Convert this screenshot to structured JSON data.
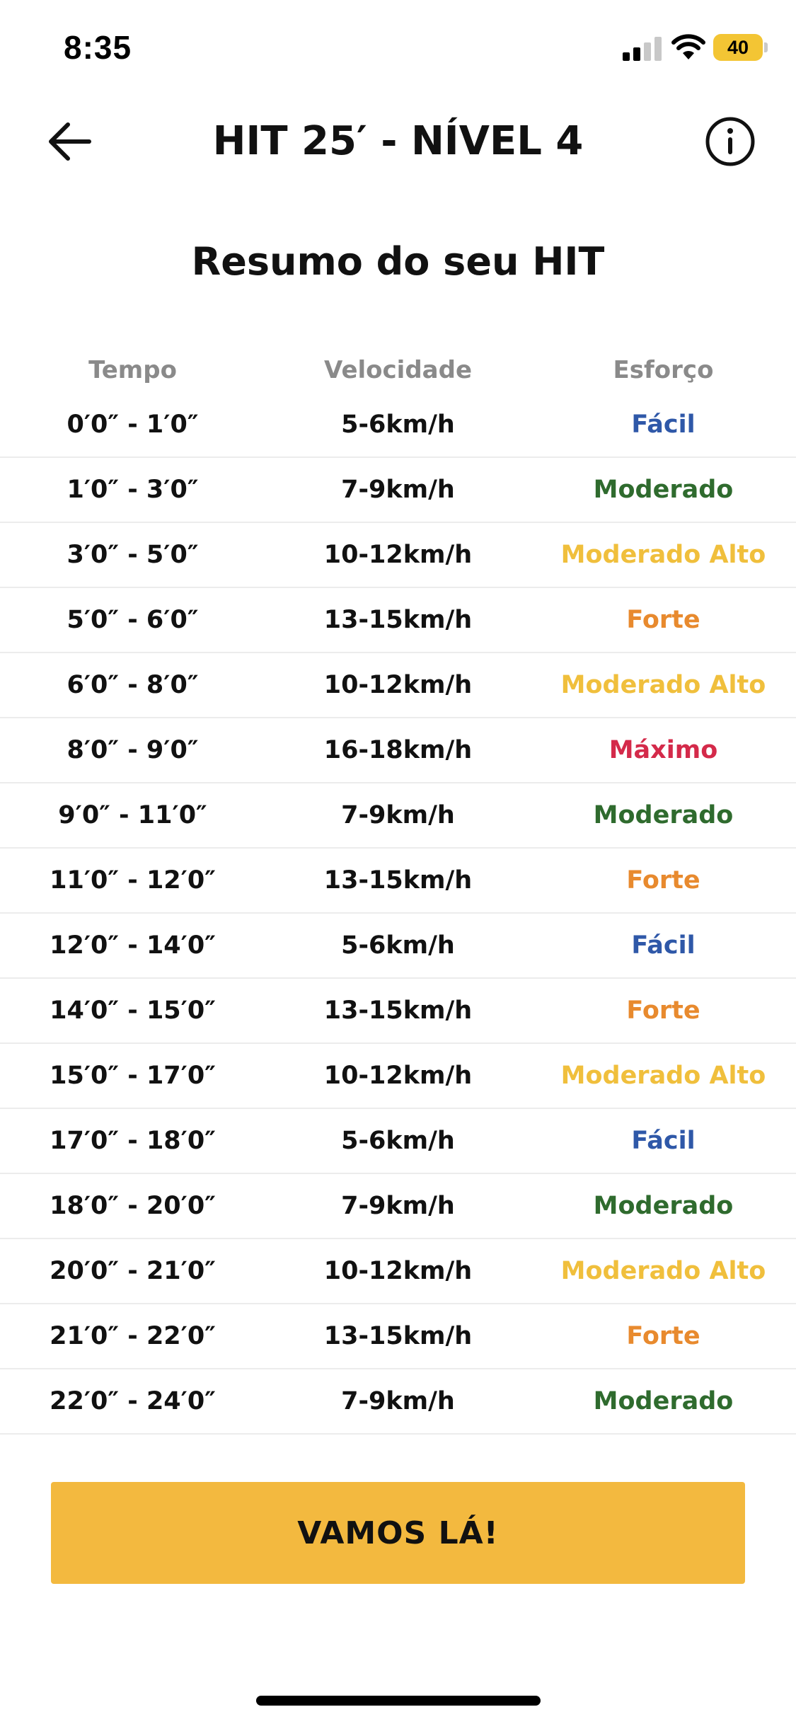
{
  "status_bar": {
    "time": "8:35",
    "battery": "40",
    "signal_icon": "cellular-signal-icon",
    "wifi_icon": "wifi-icon"
  },
  "header": {
    "title": "HIT 25′ - NÍVEL 4",
    "back_icon": "arrow-left-icon",
    "info_icon": "info-circle-icon"
  },
  "summary": {
    "title": "Resumo do seu HIT"
  },
  "table": {
    "headers": {
      "time": "Tempo",
      "speed": "Velocidade",
      "effort": "Esforço"
    },
    "rows": [
      {
        "time": "0′0″ - 1′0″",
        "speed": "5-6km/h",
        "effort": "Fácil"
      },
      {
        "time": "1′0″ - 3′0″",
        "speed": "7-9km/h",
        "effort": "Moderado"
      },
      {
        "time": "3′0″ - 5′0″",
        "speed": "10-12km/h",
        "effort": "Moderado Alto"
      },
      {
        "time": "5′0″ - 6′0″",
        "speed": "13-15km/h",
        "effort": "Forte"
      },
      {
        "time": "6′0″ - 8′0″",
        "speed": "10-12km/h",
        "effort": "Moderado Alto"
      },
      {
        "time": "8′0″ - 9′0″",
        "speed": "16-18km/h",
        "effort": "Máximo"
      },
      {
        "time": "9′0″ - 11′0″",
        "speed": "7-9km/h",
        "effort": "Moderado"
      },
      {
        "time": "11′0″ - 12′0″",
        "speed": "13-15km/h",
        "effort": "Forte"
      },
      {
        "time": "12′0″ - 14′0″",
        "speed": "5-6km/h",
        "effort": "Fácil"
      },
      {
        "time": "14′0″ - 15′0″",
        "speed": "13-15km/h",
        "effort": "Forte"
      },
      {
        "time": "15′0″ - 17′0″",
        "speed": "10-12km/h",
        "effort": "Moderado Alto"
      },
      {
        "time": "17′0″ - 18′0″",
        "speed": "5-6km/h",
        "effort": "Fácil"
      },
      {
        "time": "18′0″ - 20′0″",
        "speed": "7-9km/h",
        "effort": "Moderado"
      },
      {
        "time": "20′0″ - 21′0″",
        "speed": "10-12km/h",
        "effort": "Moderado Alto"
      },
      {
        "time": "21′0″ - 22′0″",
        "speed": "13-15km/h",
        "effort": "Forte"
      },
      {
        "time": "22′0″ - 24′0″",
        "speed": "7-9km/h",
        "effort": "Moderado"
      }
    ]
  },
  "effort_colors": {
    "Fácil": "#2f58a8",
    "Moderado": "#2f6b2e",
    "Moderado Alto": "#f0bf3c",
    "Forte": "#e88a2e",
    "Máximo": "#d42a4a"
  },
  "cta": {
    "label": "VAMOS LÁ!",
    "color": "#f3b93f"
  }
}
